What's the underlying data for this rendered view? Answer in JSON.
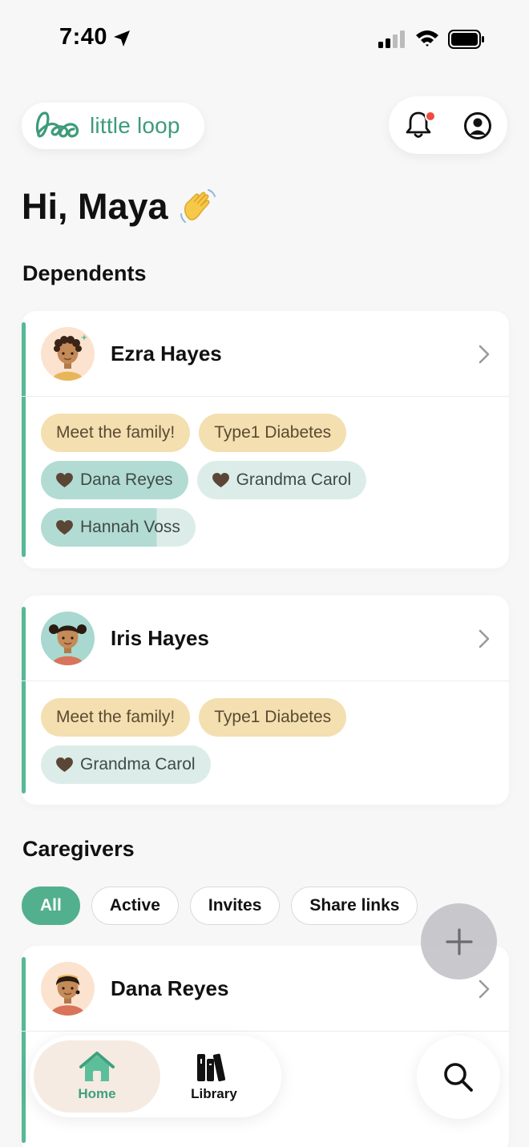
{
  "status_bar": {
    "time": "7:40"
  },
  "header": {
    "logo_text": "little loop"
  },
  "greeting": "Hi, Maya",
  "dependents_title": "Dependents",
  "dependents": [
    {
      "name": "Ezra Hayes",
      "tags": [
        "Meet the family!",
        "Type1 Diabetes"
      ],
      "caregivers": [
        "Dana Reyes",
        "Grandma Carol",
        "Hannah Voss"
      ]
    },
    {
      "name": "Iris Hayes",
      "tags": [
        "Meet the family!",
        "Type1 Diabetes"
      ],
      "caregivers": [
        "Grandma Carol"
      ]
    }
  ],
  "caregivers_title": "Caregivers",
  "filters": [
    {
      "label": "All",
      "active": true
    },
    {
      "label": "Active",
      "active": false
    },
    {
      "label": "Invites",
      "active": false
    },
    {
      "label": "Share links",
      "active": false
    }
  ],
  "caregiver_list": [
    {
      "name": "Dana Reyes"
    }
  ],
  "nav": {
    "home": "Home",
    "library": "Library"
  },
  "colors": {
    "accent": "#56b894",
    "brand": "#3d9b79",
    "tag_yellow": "#f4dfb0",
    "tag_teal": "#b2dcd3",
    "notification": "#ef4b3f"
  },
  "icons": [
    "location-arrow-icon",
    "signal-icon",
    "wifi-icon",
    "battery-icon",
    "bell-icon",
    "account-icon",
    "chevron-right-icon",
    "heart-icon",
    "plus-icon",
    "home-icon",
    "library-icon",
    "search-icon"
  ]
}
